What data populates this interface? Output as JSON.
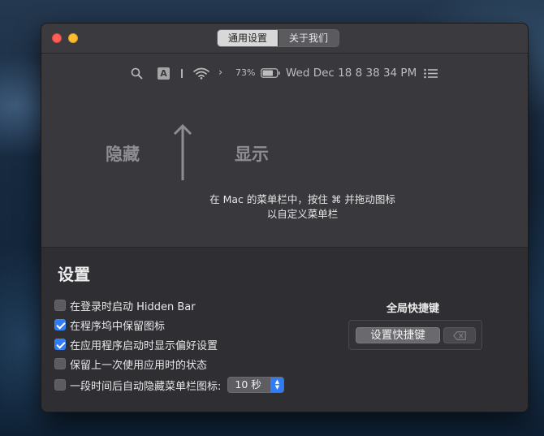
{
  "tabs": [
    {
      "label": "通用设置",
      "active": true
    },
    {
      "label": "关于我们",
      "active": false
    }
  ],
  "menubar_preview": {
    "icons": [
      "search-icon",
      "input-source-icon",
      "separator-icon",
      "wifi-icon",
      "chevron-right-icon",
      "battery-icon",
      "control-center-icon"
    ],
    "input_source_letter": "A",
    "battery_percent": "73%",
    "clock": "Wed Dec 18  8 38 34 PM"
  },
  "illustration": {
    "hide_label": "隐藏",
    "show_label": "显示",
    "instruction_line1": "在 Mac 的菜单栏中，按住 ⌘ 并拖动图标",
    "instruction_line2": "以自定义菜单栏"
  },
  "settings": {
    "title": "设置",
    "options": [
      {
        "label": "在登录时启动 Hidden Bar",
        "checked": false
      },
      {
        "label": "在程序坞中保留图标",
        "checked": true
      },
      {
        "label": "在应用程序启动时显示偏好设置",
        "checked": true
      },
      {
        "label": "保留上一次使用应用时的状态",
        "checked": false
      },
      {
        "label": "一段时间后自动隐藏菜单栏图标:",
        "checked": false
      }
    ],
    "auto_hide_delay": "10 秒"
  },
  "shortcut": {
    "title": "全局快捷键",
    "button_label": "设置快捷键",
    "clear_icon": "clear-icon"
  },
  "colors": {
    "accent": "#2f7cf6",
    "close": "#ff5f57",
    "minimize": "#febc2e"
  }
}
